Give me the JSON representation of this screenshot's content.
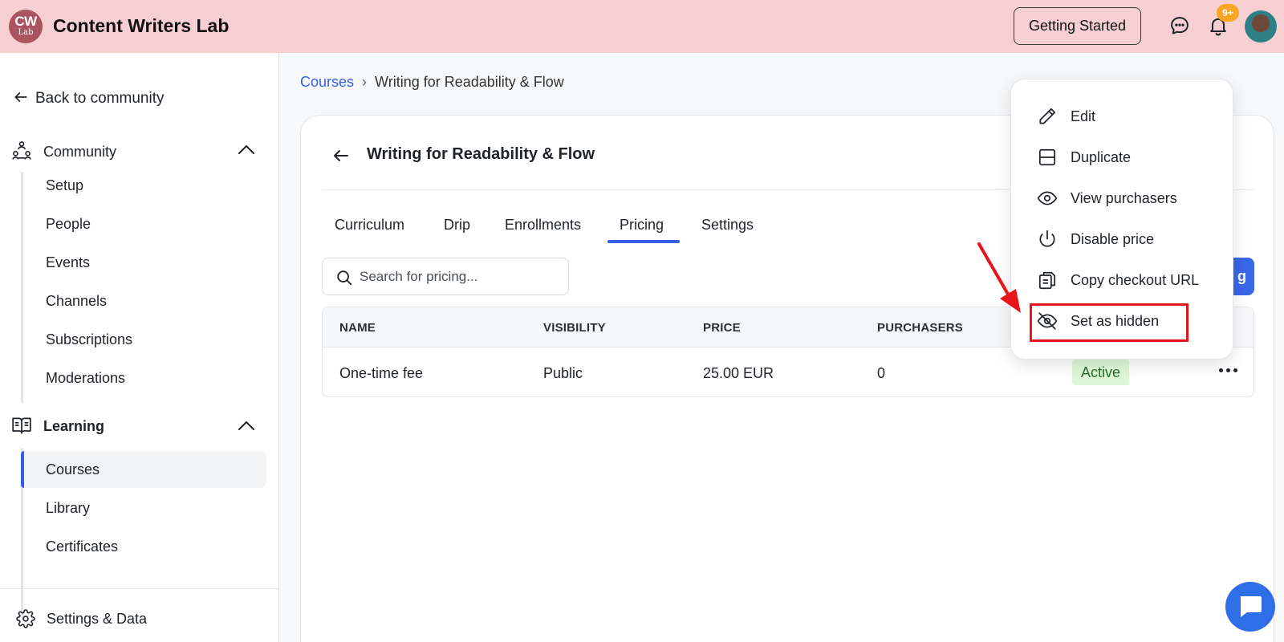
{
  "header": {
    "logo_line1": "CW",
    "logo_line2": "Lab",
    "brand": "Content Writers Lab",
    "getting_started": "Getting Started",
    "notification_count": "9+",
    "icons": [
      "chat-bubble-icon",
      "bell-icon",
      "user-avatar"
    ]
  },
  "sidebar": {
    "back": "Back to community",
    "sections": [
      {
        "title": "Community",
        "icon": "community-icon",
        "items": [
          "Setup",
          "People",
          "Events",
          "Channels",
          "Subscriptions",
          "Moderations"
        ]
      },
      {
        "title": "Learning",
        "icon": "book-icon",
        "items": [
          "Courses",
          "Library",
          "Certificates"
        ]
      }
    ],
    "active_item": "Courses",
    "footer": "Settings & Data"
  },
  "breadcrumb": {
    "root": "Courses",
    "current": "Writing for Readability & Flow"
  },
  "course": {
    "title": "Writing for Readability & Flow",
    "tabs": [
      "Curriculum",
      "Drip",
      "Enrollments",
      "Pricing",
      "Settings"
    ],
    "active_tab": "Pricing"
  },
  "pricing": {
    "search_placeholder": "Search for pricing...",
    "add_button_fragment": "g",
    "columns": [
      "NAME",
      "VISIBILITY",
      "PRICE",
      "PURCHASERS"
    ],
    "rows": [
      {
        "name": "One-time fee",
        "visibility": "Public",
        "price": "25.00 EUR",
        "purchasers": "0",
        "status": "Active"
      }
    ]
  },
  "menu": {
    "items": [
      {
        "label": "Edit",
        "icon": "pencil-icon"
      },
      {
        "label": "Duplicate",
        "icon": "duplicate-icon"
      },
      {
        "label": "View purchasers",
        "icon": "eye-icon"
      },
      {
        "label": "Disable price",
        "icon": "power-icon"
      },
      {
        "label": "Copy checkout URL",
        "icon": "copy-icon"
      },
      {
        "label": "Set as hidden",
        "icon": "eye-off-icon"
      }
    ],
    "highlighted": "Set as hidden"
  },
  "colors": {
    "topbar": "#f6cfd2",
    "accent": "#3560e6",
    "highlight": "#e8141c",
    "active_badge_bg": "#ddf7d6"
  }
}
